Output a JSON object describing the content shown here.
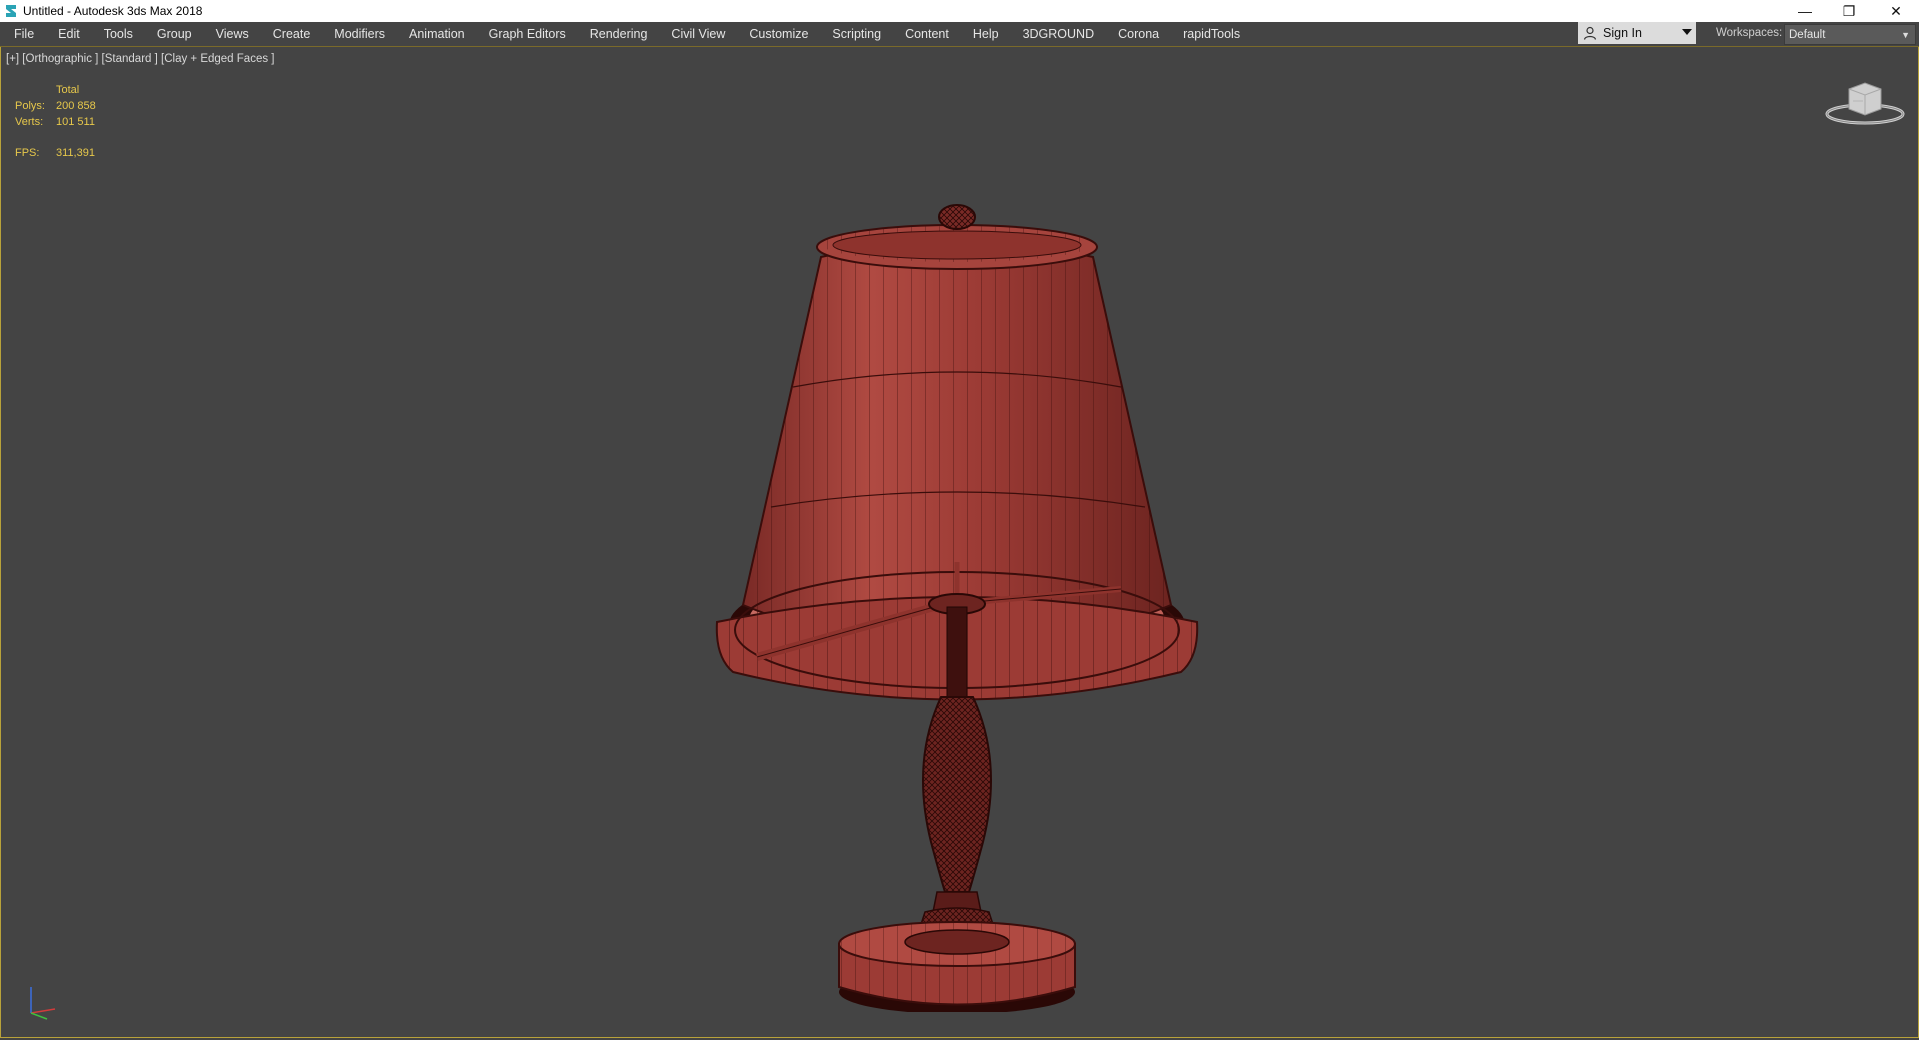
{
  "window": {
    "title": "Untitled - Autodesk 3ds Max 2018",
    "controls": {
      "minimize": "—",
      "restore": "❐",
      "close": "✕"
    }
  },
  "menu": {
    "items": [
      "File",
      "Edit",
      "Tools",
      "Group",
      "Views",
      "Create",
      "Modifiers",
      "Animation",
      "Graph Editors",
      "Rendering",
      "Civil View",
      "Customize",
      "Scripting",
      "Content",
      "Help",
      "3DGROUND",
      "Corona",
      "rapidTools"
    ]
  },
  "account": {
    "sign_in": "Sign In"
  },
  "workspaces": {
    "label": "Workspaces:",
    "value": "Default"
  },
  "viewport": {
    "label": "[+] [Orthographic ] [Standard ] [Clay + Edged Faces ]",
    "stats": {
      "header": "Total",
      "polys_label": "Polys:",
      "polys_value": "200 858",
      "verts_label": "Verts:",
      "verts_value": "101 511",
      "fps_label": "FPS:",
      "fps_value": "311,391"
    }
  },
  "colors": {
    "viewport_bg": "#444444",
    "stats_text": "#e7c84b",
    "model_fill": "#9c3b35",
    "model_wire": "#3a0d0b",
    "viewport_border": "#b8a23a"
  }
}
